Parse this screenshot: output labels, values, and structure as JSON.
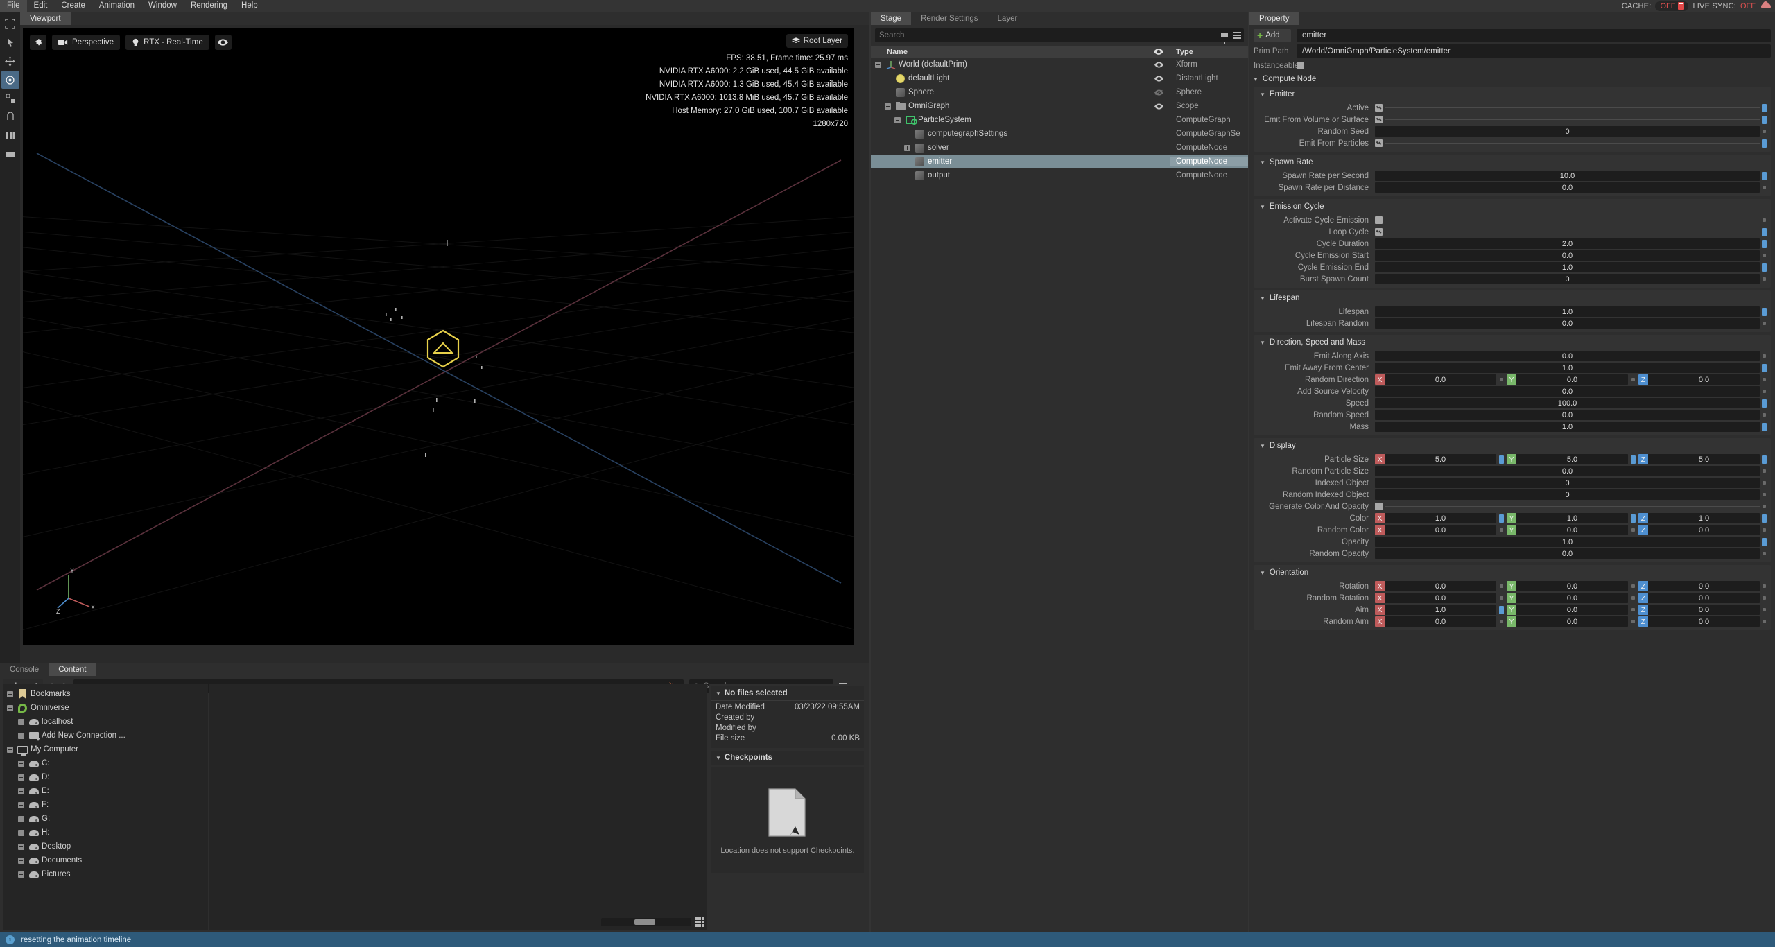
{
  "menu": {
    "items": [
      "File",
      "Edit",
      "Create",
      "Animation",
      "Window",
      "Rendering",
      "Help"
    ],
    "cache_label": "CACHE:",
    "cache_value": "OFF",
    "livesync_label": "LIVE SYNC:",
    "livesync_value": "OFF"
  },
  "left_toolbar": {
    "tools": [
      {
        "name": "select-tool"
      },
      {
        "name": "cursor-tool"
      },
      {
        "name": "move-tool"
      },
      {
        "name": "rotate-tool"
      },
      {
        "name": "scale-tool"
      },
      {
        "name": "snap-tool"
      },
      {
        "name": "measure-tool"
      },
      {
        "name": "layout-tool"
      }
    ]
  },
  "viewport": {
    "tab": "Viewport",
    "settings_icon": "gear-icon",
    "camera_label": "Perspective",
    "camera_icon": "camera-icon",
    "renderer_label": "RTX - Real-Time",
    "renderer_icon": "bulb-icon",
    "visibility_icon": "eye-icon",
    "root_layer_label": "Root Layer",
    "root_layer_icon": "layers-icon",
    "stats": [
      "FPS: 38.51, Frame time: 25.97 ms",
      "NVIDIA RTX A6000: 2.2 GiB used,  44.5 GiB available",
      "NVIDIA RTX A6000: 1.3 GiB used,  45.4 GiB available",
      "NVIDIA RTX A6000: 1013.8 MiB used,  45.7 GiB available",
      "Host Memory: 27.0 GiB used, 100.7 GiB available",
      "1280x720"
    ],
    "axis_labels": {
      "x": "X",
      "y": "Y",
      "z": "Z"
    }
  },
  "content": {
    "tabs": [
      {
        "label": "Console",
        "active": false
      },
      {
        "label": "Content",
        "active": true
      }
    ],
    "import_label": "Import",
    "path_value": "",
    "search_placeholder": "Search",
    "tree": [
      {
        "label": "Bookmarks",
        "indent": 0,
        "expander": "minus",
        "icon": "bookmark-icon"
      },
      {
        "label": "Omniverse",
        "indent": 0,
        "expander": "minus",
        "icon": "omniverse-icon"
      },
      {
        "label": "localhost",
        "indent": 1,
        "expander": "plus",
        "icon": "drive-icon"
      },
      {
        "label": "Add New Connection ...",
        "indent": 1,
        "expander": "plus",
        "icon": "new-connection-icon"
      },
      {
        "label": "My Computer",
        "indent": 0,
        "expander": "minus",
        "icon": "monitor-icon"
      },
      {
        "label": "C:",
        "indent": 1,
        "expander": "plus",
        "icon": "drive-icon"
      },
      {
        "label": "D:",
        "indent": 1,
        "expander": "plus",
        "icon": "drive-icon"
      },
      {
        "label": "E:",
        "indent": 1,
        "expander": "plus",
        "icon": "drive-icon"
      },
      {
        "label": "F:",
        "indent": 1,
        "expander": "plus",
        "icon": "drive-icon"
      },
      {
        "label": "G:",
        "indent": 1,
        "expander": "plus",
        "icon": "drive-icon"
      },
      {
        "label": "H:",
        "indent": 1,
        "expander": "plus",
        "icon": "drive-icon"
      },
      {
        "label": "Desktop",
        "indent": 1,
        "expander": "plus",
        "icon": "drive-icon"
      },
      {
        "label": "Documents",
        "indent": 1,
        "expander": "plus",
        "icon": "drive-icon"
      },
      {
        "label": "Pictures",
        "indent": 1,
        "expander": "plus",
        "icon": "drive-icon"
      }
    ],
    "detail": {
      "title": "No files selected",
      "rows": [
        {
          "key": "Date Modified",
          "value": "03/23/22 09:55AM"
        },
        {
          "key": "Created by",
          "value": ""
        },
        {
          "key": "Modified by",
          "value": ""
        },
        {
          "key": "File size",
          "value": "0.00 KB"
        }
      ],
      "checkpoints_title": "Checkpoints",
      "checkpoints_message": "Location does not support Checkpoints."
    }
  },
  "stage": {
    "tabs": [
      {
        "label": "Stage",
        "active": true
      },
      {
        "label": "Render Settings",
        "active": false
      },
      {
        "label": "Layer",
        "active": false
      }
    ],
    "search_placeholder": "Search",
    "columns": {
      "name": "Name",
      "type": "Type",
      "eye": "eye-icon"
    },
    "rows": [
      {
        "label": "World (defaultPrim)",
        "type": "Xform",
        "indent": 0,
        "expander": "minus",
        "icon": "axis-icon",
        "eye": true,
        "selected": false
      },
      {
        "label": "defaultLight",
        "type": "DistantLight",
        "indent": 1,
        "expander": "none",
        "icon": "light-icon",
        "eye": true,
        "selected": false
      },
      {
        "label": "Sphere",
        "type": "Sphere",
        "indent": 1,
        "expander": "none",
        "icon": "prim-icon",
        "eye": "off",
        "selected": false
      },
      {
        "label": "OmniGraph",
        "type": "Scope",
        "indent": 1,
        "expander": "minus",
        "icon": "folder-icon",
        "eye": true,
        "selected": false
      },
      {
        "label": "ParticleSystem",
        "type": "ComputeGraph",
        "indent": 2,
        "expander": "minus",
        "icon": "graph-icon",
        "eye": false,
        "selected": false
      },
      {
        "label": "computegraphSettings",
        "type": "ComputeGraphSé",
        "indent": 3,
        "expander": "none",
        "icon": "prim-icon",
        "eye": false,
        "selected": false
      },
      {
        "label": "solver",
        "type": "ComputeNode",
        "indent": 3,
        "expander": "plus",
        "icon": "prim-icon",
        "eye": false,
        "selected": false
      },
      {
        "label": "emitter",
        "type": "ComputeNode",
        "indent": 3,
        "expander": "none",
        "icon": "prim-icon",
        "eye": false,
        "selected": true
      },
      {
        "label": "output",
        "type": "ComputeNode",
        "indent": 3,
        "expander": "none",
        "icon": "prim-icon",
        "eye": false,
        "selected": false
      }
    ]
  },
  "property": {
    "tab": "Property",
    "add_label": "Add",
    "name_value": "emitter",
    "prim_path_label": "Prim Path",
    "prim_path_value": "/World/OmniGraph/ParticleSystem/emitter",
    "instanceable_label": "Instanceable",
    "compute_node_title": "Compute Node",
    "accent_blue": "#5a9bd4",
    "axis_colors": {
      "x": "#bf5b5b",
      "y": "#79b86a",
      "z": "#4e8fd0"
    },
    "sections": [
      {
        "title": "Emitter",
        "rows": [
          {
            "label": "Active",
            "kind": "checkbox",
            "checked": true,
            "marker": "blue"
          },
          {
            "label": "Emit From Volume or Surface",
            "kind": "checkbox",
            "checked": true,
            "marker": "blue"
          },
          {
            "label": "Random Seed",
            "kind": "scalar",
            "value": "0",
            "marker": "grey"
          },
          {
            "label": "Emit From Particles",
            "kind": "checkbox",
            "checked": true,
            "marker": "blue"
          }
        ]
      },
      {
        "title": "Spawn Rate",
        "rows": [
          {
            "label": "Spawn Rate per Second",
            "kind": "scalar",
            "value": "10.0",
            "marker": "blue"
          },
          {
            "label": "Spawn Rate per Distance",
            "kind": "scalar",
            "value": "0.0",
            "marker": "grey"
          }
        ]
      },
      {
        "title": "Emission Cycle",
        "rows": [
          {
            "label": "Activate Cycle Emission",
            "kind": "checkbox",
            "checked": false,
            "marker": "grey"
          },
          {
            "label": "Loop Cycle",
            "kind": "checkbox",
            "checked": true,
            "marker": "blue"
          },
          {
            "label": "Cycle Duration",
            "kind": "scalar",
            "value": "2.0",
            "marker": "blue"
          },
          {
            "label": "Cycle Emission Start",
            "kind": "scalar",
            "value": "0.0",
            "marker": "grey"
          },
          {
            "label": "Cycle Emission End",
            "kind": "scalar",
            "value": "1.0",
            "marker": "blue"
          },
          {
            "label": "Burst Spawn Count",
            "kind": "scalar",
            "value": "0",
            "marker": "grey"
          }
        ]
      },
      {
        "title": "Lifespan",
        "rows": [
          {
            "label": "Lifespan",
            "kind": "scalar",
            "value": "1.0",
            "marker": "blue"
          },
          {
            "label": "Lifespan Random",
            "kind": "scalar",
            "value": "0.0",
            "marker": "grey"
          }
        ]
      },
      {
        "title": "Direction, Speed and Mass",
        "rows": [
          {
            "label": "Emit Along Axis",
            "kind": "scalar",
            "value": "0.0",
            "marker": "grey"
          },
          {
            "label": "Emit Away From Center",
            "kind": "scalar",
            "value": "1.0",
            "marker": "blue"
          },
          {
            "label": "Random Direction",
            "kind": "vec3",
            "values": [
              "0.0",
              "0.0",
              "0.0"
            ],
            "inner_markers": [
              "grey",
              "grey"
            ],
            "marker": "grey"
          },
          {
            "label": "Add Source Velocity",
            "kind": "scalar",
            "value": "0.0",
            "marker": "grey"
          },
          {
            "label": "Speed",
            "kind": "scalar",
            "value": "100.0",
            "marker": "blue"
          },
          {
            "label": "Random Speed",
            "kind": "scalar",
            "value": "0.0",
            "marker": "grey"
          },
          {
            "label": "Mass",
            "kind": "scalar",
            "value": "1.0",
            "marker": "blue"
          }
        ]
      },
      {
        "title": "Display",
        "rows": [
          {
            "label": "Particle Size",
            "kind": "vec3",
            "values": [
              "5.0",
              "5.0",
              "5.0"
            ],
            "inner_markers": [
              "blue",
              "blue"
            ],
            "marker": "blue"
          },
          {
            "label": "Random Particle Size",
            "kind": "scalar",
            "value": "0.0",
            "marker": "grey"
          },
          {
            "label": "Indexed Object",
            "kind": "scalar",
            "value": "0",
            "marker": "grey"
          },
          {
            "label": "Random Indexed Object",
            "kind": "scalar",
            "value": "0",
            "marker": "grey"
          },
          {
            "label": "Generate Color And Opacity",
            "kind": "checkbox",
            "checked": false,
            "marker": "grey"
          },
          {
            "label": "Color",
            "kind": "vec3",
            "values": [
              "1.0",
              "1.0",
              "1.0"
            ],
            "inner_markers": [
              "blue",
              "blue"
            ],
            "marker": "blue"
          },
          {
            "label": "Random Color",
            "kind": "vec3",
            "values": [
              "0.0",
              "0.0",
              "0.0"
            ],
            "inner_markers": [
              "grey",
              "grey"
            ],
            "marker": "grey"
          },
          {
            "label": "Opacity",
            "kind": "scalar",
            "value": "1.0",
            "marker": "blue"
          },
          {
            "label": "Random Opacity",
            "kind": "scalar",
            "value": "0.0",
            "marker": "grey"
          }
        ]
      },
      {
        "title": "Orientation",
        "rows": [
          {
            "label": "Rotation",
            "kind": "vec3",
            "values": [
              "0.0",
              "0.0",
              "0.0"
            ],
            "inner_markers": [
              "grey",
              "grey"
            ],
            "marker": "grey"
          },
          {
            "label": "Random Rotation",
            "kind": "vec3",
            "values": [
              "0.0",
              "0.0",
              "0.0"
            ],
            "inner_markers": [
              "grey",
              "grey"
            ],
            "marker": "grey"
          },
          {
            "label": "Aim",
            "kind": "vec3",
            "values": [
              "1.0",
              "0.0",
              "0.0"
            ],
            "inner_markers": [
              "blue",
              "grey"
            ],
            "marker": "grey"
          },
          {
            "label": "Random Aim",
            "kind": "vec3",
            "values": [
              "0.0",
              "0.0",
              "0.0"
            ],
            "inner_markers": [
              "grey",
              "grey"
            ],
            "marker": "grey"
          }
        ]
      }
    ]
  },
  "statusbar": {
    "message": "resetting the animation timeline",
    "icon": "info-icon"
  }
}
